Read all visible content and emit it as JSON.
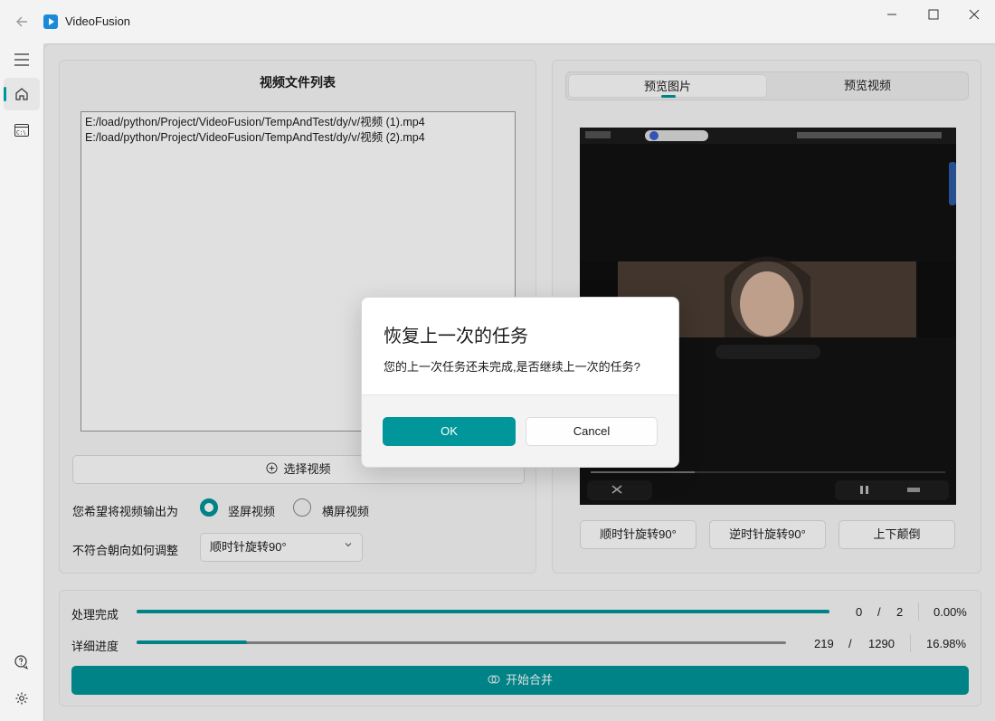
{
  "window": {
    "title": "VideoFusion",
    "controls": [
      "minimize",
      "maximize",
      "close"
    ]
  },
  "sidebar": {
    "items": [
      {
        "icon": "menu-icon"
      },
      {
        "icon": "home-icon",
        "active": true
      },
      {
        "icon": "terminal-icon"
      },
      {
        "icon": "chat-help-icon"
      },
      {
        "icon": "gear-icon"
      }
    ]
  },
  "left_panel": {
    "title": "视频文件列表",
    "files": [
      "E:/load/python/Project/VideoFusion/TempAndTest/dy/v/视频  (1).mp4",
      "E:/load/python/Project/VideoFusion/TempAndTest/dy/v/视频  (2).mp4"
    ],
    "select_button": "选择视频",
    "output_label": "您希望将视频输出为",
    "orientation_options": [
      "竖屏视频",
      "横屏视频"
    ],
    "orientation_selected": "竖屏视频",
    "adjust_label": "不符合朝向如何调整",
    "adjust_value": "顺时针旋转90°"
  },
  "right_panel": {
    "tabs": [
      "预览图片",
      "预览视频"
    ],
    "active_tab": "预览图片",
    "rotate_buttons": [
      "顺时针旋转90°",
      "逆时针旋转90°",
      "上下颠倒"
    ]
  },
  "progress": {
    "done_label": "处理完成",
    "done_current": "0",
    "done_total": "2",
    "done_percent": "0.00%",
    "done_bar_fill": 1.0,
    "detail_label": "详细进度",
    "detail_current": "219",
    "detail_total": "1290",
    "detail_percent": "16.98%",
    "detail_bar_fill": 0.1698,
    "separator": "/",
    "start_button": "开始合并"
  },
  "dialog": {
    "title": "恢复上一次的任务",
    "message": "您的上一次任务还未完成,是否继续上一次的任务?",
    "ok": "OK",
    "cancel": "Cancel"
  },
  "colors": {
    "accent": "#00969a"
  }
}
